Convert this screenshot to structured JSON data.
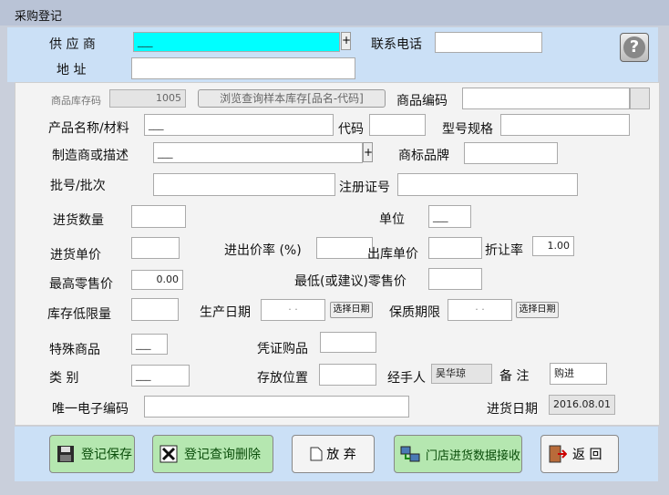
{
  "window": {
    "title": "采购登记"
  },
  "top": {
    "supplier_label": "供 应 商",
    "supplier_value": "___",
    "supplier_add": "+",
    "phone_label": "联系电话",
    "phone_value": "",
    "address_label": "地  址",
    "address_value": "",
    "help_icon": "?"
  },
  "form": {
    "stock_code_label": "商品库存码",
    "stock_code_value": "1005",
    "browse_button": "浏览查询样本库存[品名-代码]",
    "item_code_label": "商品编码",
    "product_name_label": "产品名称/材料",
    "product_name_value": "___",
    "code_label": "代码",
    "model_label": "型号规格",
    "maker_label": "制造商或描述",
    "maker_value": "___",
    "maker_add": "+",
    "brand_label": "商标品牌",
    "batch_label": "批号/批次",
    "reg_label": "注册证号",
    "qty_label": "进货数量",
    "unit_label": "单位",
    "unit_value": "___",
    "price_label": "进货单价",
    "markup_label": "进出价率 (%)",
    "out_price_label": "出库单价",
    "discount_label": "折让率",
    "discount_value": "1.00",
    "max_retail_label": "最高零售价",
    "max_retail_value": "0.00",
    "min_retail_label": "最低(或建议)零售价",
    "min_stock_label": "库存低限量",
    "prod_date_label": "生产日期",
    "prod_date_value": "·  ·",
    "pick_date": "选择日期",
    "expiry_label": "保质期限",
    "expiry_value": "·  ·",
    "special_label": "特殊商品",
    "special_value": "___",
    "voucher_label": "凭证购品",
    "category_label": "类  别",
    "category_value": "___",
    "location_label": "存放位置",
    "handler_label": "经手人",
    "handler_value": "吴华琼",
    "remark_label": "备  注",
    "remark_value": "购进",
    "ecode_label": "唯一电子编码",
    "date_label": "进货日期",
    "date_value": "2016.08.01"
  },
  "actions": {
    "save": "登记保存",
    "query_delete": "登记查询删除",
    "discard": "放 弃",
    "receive": "门店进货数据接收",
    "back": "返 回"
  },
  "colors": {
    "panel_blue": "#cbe0f6",
    "cyan_field": "#00ffff",
    "save_green": "#b5e7b0"
  }
}
